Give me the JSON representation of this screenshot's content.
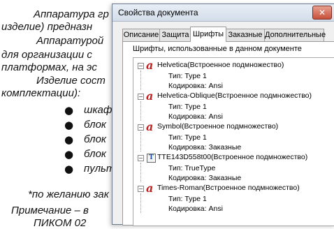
{
  "background_doc": {
    "lines": [
      "Аппаратура гр",
      "изделие) предназн",
      "Аппаратурой",
      "для организации с",
      "платформах, на эс",
      "Изделие сост",
      "комплектации):"
    ],
    "bullets": [
      "шкаф",
      "блок",
      "блок",
      "блок",
      "пульт"
    ],
    "footnote": "*по желанию зак",
    "note": "Примечание – в",
    "last": "ПИКОМ 02"
  },
  "dialog": {
    "title": "Свойства документа",
    "close_symbol": "✕",
    "tabs": [
      "Описание",
      "Защита",
      "Шрифты",
      "Заказные",
      "Дополнительные"
    ],
    "active_tab": "Шрифты",
    "panel_header": "Шрифты, использованные в данном документе",
    "fonts": [
      {
        "name": "Helvetica(Встроенное подмножество)",
        "icon": "type1-font-icon",
        "type": "Тип: Type 1",
        "encoding": "Кодировка: Ansi"
      },
      {
        "name": "Helvetica-Oblique(Встроенное подмножество)",
        "icon": "type1-font-icon",
        "type": "Тип: Type 1",
        "encoding": "Кодировка: Ansi"
      },
      {
        "name": "Symbol(Встроенное подмножество)",
        "icon": "type1-font-icon",
        "type": "Тип: Type 1",
        "encoding": "Кодировка: Заказные"
      },
      {
        "name": "TTE143D558t00(Встроенное подмножество)",
        "icon": "truetype-font-icon",
        "type": "Тип: TrueType",
        "encoding": "Кодировка: Заказные"
      },
      {
        "name": "Times-Roman(Встроенное подмножество)",
        "icon": "type1-font-icon",
        "type": "Тип: Type 1",
        "encoding": "Кодировка: Ansi"
      }
    ],
    "toggle_symbol": "−",
    "type1_glyph": "a",
    "truetype_glyph": "T"
  }
}
